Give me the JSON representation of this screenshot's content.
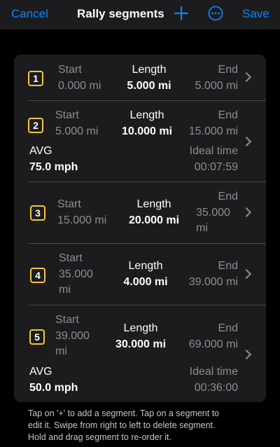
{
  "navbar": {
    "cancel_label": "Cancel",
    "title": "Rally segments",
    "add_icon": "plus-icon",
    "more_icon": "ellipsis-circle-icon",
    "save_label": "Save"
  },
  "labels": {
    "start": "Start",
    "length": "Length",
    "end": "End",
    "avg": "AVG",
    "ideal_time": "Ideal time"
  },
  "segments": [
    {
      "number": "1",
      "start": "0.000 mi",
      "length": "5.000 mi",
      "end": "5.000 mi"
    },
    {
      "number": "2",
      "start": "5.000 mi",
      "length": "10.000 mi",
      "end": "15.000 mi",
      "avg": "75.0 mph",
      "ideal_time": "00:07:59"
    },
    {
      "number": "3",
      "start": "15.000 mi",
      "length": "20.000 mi",
      "end_line1": "35.000",
      "end_line2": "mi"
    },
    {
      "number": "4",
      "start_line1": "35.000",
      "start_line2": "mi",
      "length": "4.000 mi",
      "end": "39.000 mi"
    },
    {
      "number": "5",
      "start_line1": "39.000",
      "start_line2": "mi",
      "length": "30.000 mi",
      "end": "69.000 mi",
      "avg": "50.0 mph",
      "ideal_time": "00:36:00"
    }
  ],
  "footer": {
    "line1": "Tap on '+' to add a segment. Tap on a segment to",
    "line2": "edit it.  Swipe from right to left to delete segment.",
    "line3": "Hold and drag segment to re-order it."
  },
  "colors": {
    "accent": "#0a84ff",
    "badge_border": "#f2c73d",
    "card_bg": "#1c1c1e"
  }
}
